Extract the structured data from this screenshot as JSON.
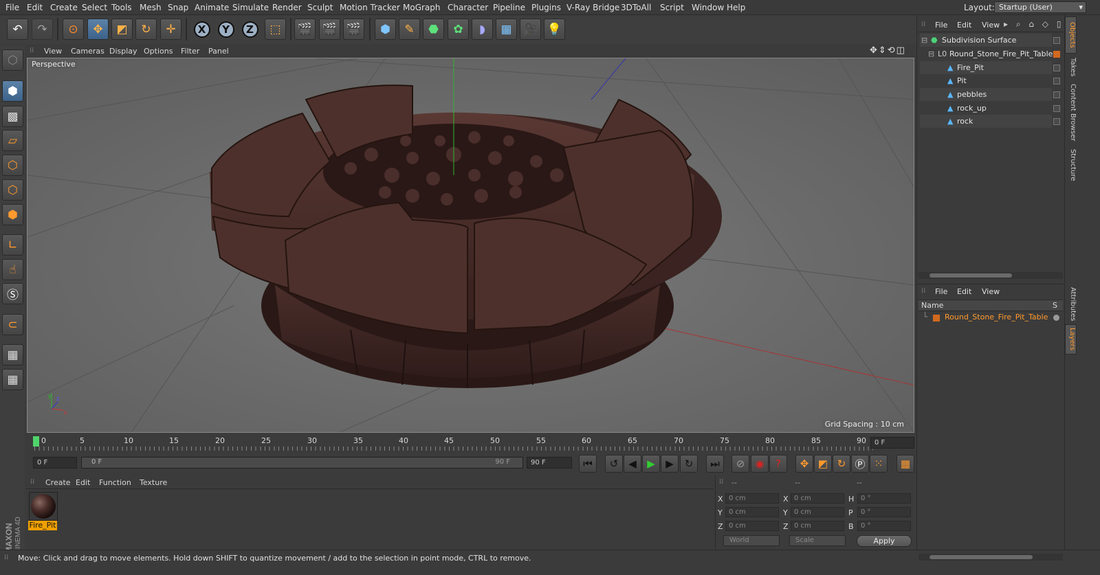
{
  "menu": [
    "File",
    "Edit",
    "Create",
    "Select",
    "Tools",
    "Mesh",
    "Snap",
    "Animate",
    "Simulate",
    "Render",
    "Sculpt",
    "Motion Tracker",
    "MoGraph",
    "Character",
    "Pipeline",
    "Plugins",
    "V-Ray Bridge",
    "3DToAll",
    "Script",
    "Window",
    "Help"
  ],
  "layout": {
    "label": "Layout:",
    "value": "Startup (User)"
  },
  "viewport_menu": [
    "View",
    "Cameras",
    "Display",
    "Options",
    "Filter",
    "Panel"
  ],
  "viewport": {
    "camera": "Perspective",
    "grid_spacing": "Grid Spacing : 10 cm"
  },
  "timeline": {
    "ticks": [
      "0",
      "5",
      "10",
      "15",
      "20",
      "25",
      "30",
      "35",
      "40",
      "45",
      "50",
      "55",
      "60",
      "65",
      "70",
      "75",
      "80",
      "85",
      "90"
    ],
    "current_frame": "0 F"
  },
  "transport": {
    "start": "0 F",
    "slider_start": "0 F",
    "slider_end": "90 F",
    "end": "90 F"
  },
  "material_menu": [
    "Create",
    "Edit",
    "Function",
    "Texture"
  ],
  "material": {
    "name": "Fire_Pit"
  },
  "coords": {
    "col_headers": [
      "--",
      "--",
      "--"
    ],
    "rows": [
      {
        "a": "X",
        "av": "0 cm",
        "b": "X",
        "bv": "0 cm",
        "c": "H",
        "cv": "0 °"
      },
      {
        "a": "Y",
        "av": "0 cm",
        "b": "Y",
        "bv": "0 cm",
        "c": "P",
        "cv": "0 °"
      },
      {
        "a": "Z",
        "av": "0 cm",
        "b": "Z",
        "bv": "0 cm",
        "c": "B",
        "cv": "0 °"
      }
    ],
    "world": "World",
    "scale": "Scale",
    "apply": "Apply"
  },
  "object_manager": {
    "menu": [
      "File",
      "Edit",
      "View"
    ],
    "items": [
      "Subdivision Surface",
      "Round_Stone_Fire_Pit_Table",
      "Fire_Pit",
      "Pit",
      "pebbles",
      "rock_up",
      "rock"
    ]
  },
  "layer_manager": {
    "menu": [
      "File",
      "Edit",
      "View"
    ],
    "col_name": "Name",
    "col_s": "S",
    "layer": "Round_Stone_Fire_Pit_Table"
  },
  "side_tabs": [
    "Objects",
    "Takes",
    "Content Browser",
    "Structure",
    "Attributes",
    "Layers"
  ],
  "status": "Move: Click and drag to move elements. Hold down SHIFT to quantize movement / add to the selection in point mode, CTRL to remove.",
  "brand": {
    "line1": "MAXON",
    "line2": "CINEMA 4D"
  }
}
